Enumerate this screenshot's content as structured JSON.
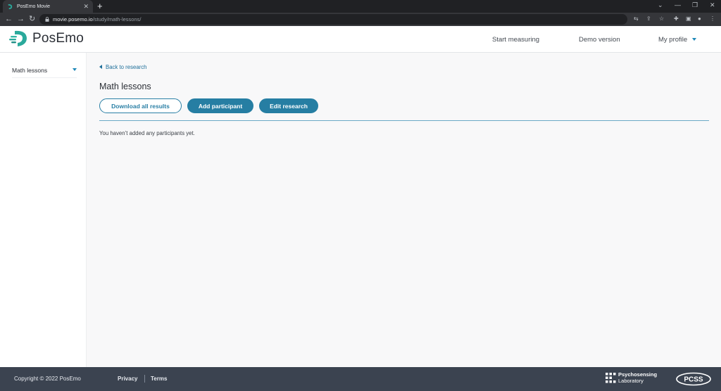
{
  "browser": {
    "tab_title": "PosEmo Movie",
    "url_host": "movie.posemo.io",
    "url_path": "/study/math-lessons/"
  },
  "header": {
    "logo_text": "PosEmo",
    "nav": {
      "start_measuring": "Start measuring",
      "demo_version": "Demo version",
      "my_profile": "My profile"
    }
  },
  "sidebar": {
    "items": [
      {
        "label": "Math lessons"
      }
    ]
  },
  "main": {
    "back_link": "Back to research",
    "title": "Math lessons",
    "buttons": {
      "download_all": "Download all results",
      "add_participant": "Add participant",
      "edit_research": "Edit research"
    },
    "empty_message": "You haven’t added any participants yet."
  },
  "footer": {
    "copyright": "Copyright © 2022 PosEmo",
    "privacy": "Privacy",
    "terms": "Terms",
    "lab_line1": "Psychosensing",
    "lab_line2": "Laboratory",
    "pcss_logo": "PCSS"
  },
  "colors": {
    "accent": "#267ea3",
    "logo_teal": "#2aa99b",
    "footer_bg": "#3b4350"
  },
  "icons": [
    "back-icon",
    "forward-icon",
    "reload-icon",
    "lock-icon",
    "caret-down-icon",
    "back-arrow-icon"
  ]
}
